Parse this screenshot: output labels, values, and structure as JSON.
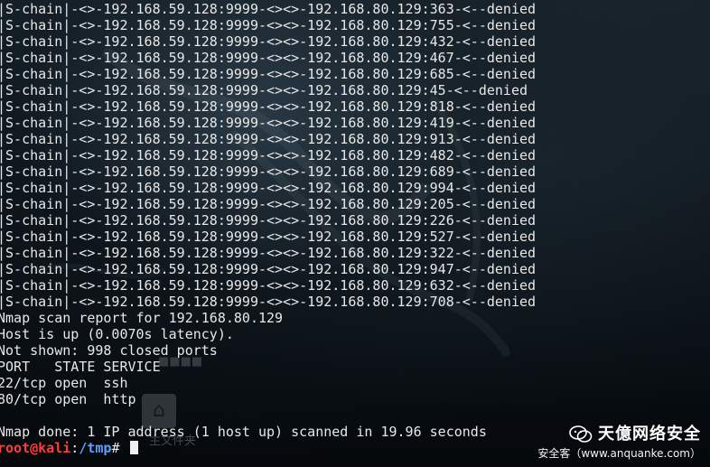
{
  "terminal": {
    "output_lines": [
      "|S-chain|-<>-192.168.59.128:9999-<><>-192.168.80.129:363-<--denied",
      "|S-chain|-<>-192.168.59.128:9999-<><>-192.168.80.129:755-<--denied",
      "|S-chain|-<>-192.168.59.128:9999-<><>-192.168.80.129:432-<--denied",
      "|S-chain|-<>-192.168.59.128:9999-<><>-192.168.80.129:467-<--denied",
      "|S-chain|-<>-192.168.59.128:9999-<><>-192.168.80.129:685-<--denied",
      "|S-chain|-<>-192.168.59.128:9999-<><>-192.168.80.129:45-<--denied",
      "|S-chain|-<>-192.168.59.128:9999-<><>-192.168.80.129:818-<--denied",
      "|S-chain|-<>-192.168.59.128:9999-<><>-192.168.80.129:419-<--denied",
      "|S-chain|-<>-192.168.59.128:9999-<><>-192.168.80.129:913-<--denied",
      "|S-chain|-<>-192.168.59.128:9999-<><>-192.168.80.129:482-<--denied",
      "|S-chain|-<>-192.168.59.128:9999-<><>-192.168.80.129:689-<--denied",
      "|S-chain|-<>-192.168.59.128:9999-<><>-192.168.80.129:994-<--denied",
      "|S-chain|-<>-192.168.59.128:9999-<><>-192.168.80.129:205-<--denied",
      "|S-chain|-<>-192.168.59.128:9999-<><>-192.168.80.129:226-<--denied",
      "|S-chain|-<>-192.168.59.128:9999-<><>-192.168.80.129:527-<--denied",
      "|S-chain|-<>-192.168.59.128:9999-<><>-192.168.80.129:322-<--denied",
      "|S-chain|-<>-192.168.59.128:9999-<><>-192.168.80.129:947-<--denied",
      "|S-chain|-<>-192.168.59.128:9999-<><>-192.168.80.129:632-<--denied",
      "|S-chain|-<>-192.168.59.128:9999-<><>-192.168.80.129:708-<--denied",
      "Nmap scan report for 192.168.80.129",
      "Host is up (0.0070s latency).",
      "Not shown: 998 closed ports",
      "PORT   STATE SERVICE",
      "22/tcp open  ssh",
      "80/tcp open  http",
      "",
      "Nmap done: 1 IP address (1 host up) scanned in 19.96 seconds"
    ],
    "prompt": {
      "user_host": "root@kali",
      "separator": ":",
      "path": "/tmp",
      "symbol": "# "
    }
  },
  "desktop": {
    "icon_name": "home-icon",
    "icon_label": "主文件夹"
  },
  "watermark": {
    "brand": "天億网络安全",
    "subtitle": "安全客（www.anquanke.com）",
    "logo_icon": "wechat-icon"
  },
  "colors": {
    "prompt_user": "#ff3b3b",
    "prompt_path": "#5aa0ff",
    "text": "#e8e8e8"
  }
}
